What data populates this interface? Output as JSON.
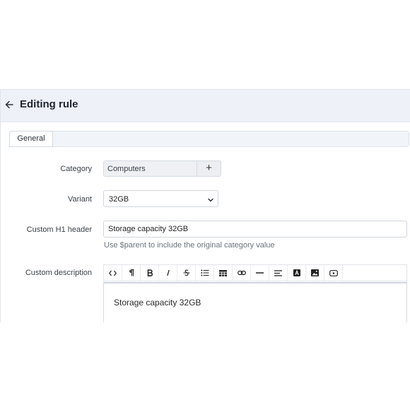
{
  "page": {
    "title": "Editing rule",
    "back_icon": "arrow-left-icon"
  },
  "tabs": [
    {
      "label": "General",
      "active": true
    }
  ],
  "form": {
    "category": {
      "label": "Category",
      "value": "Computers",
      "add_icon": "plus-icon"
    },
    "variant": {
      "label": "Variant",
      "value": "32GB",
      "caret_icon": "chevron-down-icon"
    },
    "custom_h1": {
      "label": "Custom H1 header",
      "value": "Storage capacity 32GB",
      "hint": "Use $parent to include the original category value"
    },
    "custom_description": {
      "label": "Custom description",
      "content": "Storage capacity 32GB",
      "toolbar": [
        "code-icon",
        "paragraph-icon",
        "bold-icon",
        "italic-icon",
        "strikethrough-icon",
        "bullet-list-icon",
        "table-icon",
        "link-icon",
        "horizontal-rule-icon",
        "align-icon",
        "text-color-icon",
        "image-icon",
        "video-icon"
      ]
    }
  },
  "colors": {
    "header_bg": "#eef2f8",
    "border": "#d5dbe3",
    "hint_text": "#6c757d"
  }
}
